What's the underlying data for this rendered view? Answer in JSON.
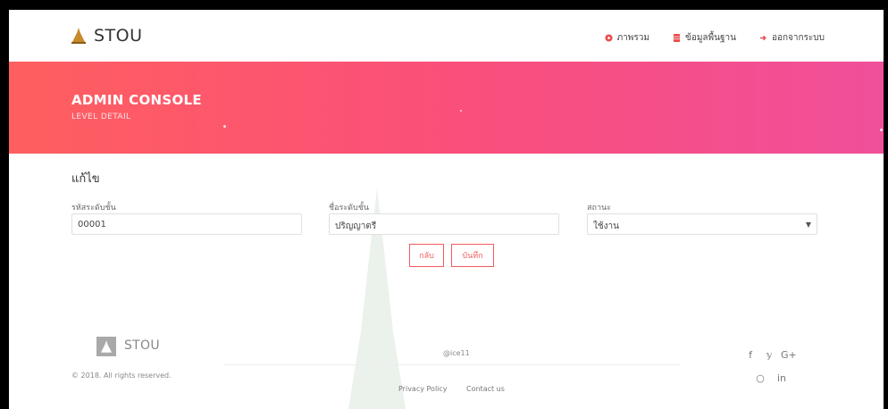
{
  "navbar": {
    "brand": "STOU",
    "items": [
      {
        "label": "ภาพรวม",
        "icon": "dashboard-icon"
      },
      {
        "label": "ข้อมูลพื้นฐาน",
        "icon": "database-icon"
      },
      {
        "label": "ออกจากระบบ",
        "icon": "sign-out-icon"
      }
    ]
  },
  "hero": {
    "title": "ADMIN CONSOLE",
    "subtitle": "LEVEL DETAIL"
  },
  "form": {
    "title": "แก้ไข",
    "fields": [
      {
        "label": "รหัสระดับชั้น",
        "value": "00001"
      },
      {
        "label": "ชื่อระดับชั้น",
        "value": "ปริญญาตรี"
      },
      {
        "label": "สถานะ",
        "value": "ใช้งาน"
      }
    ],
    "back_label": "กลับ",
    "save_label": "บันทึก"
  },
  "footer": {
    "brand": "STOU",
    "copyright": "© 2018. All rights reserved.",
    "credit": "@ice11",
    "links": [
      "Privacy Policy",
      "Contact us"
    ],
    "social": [
      "f",
      "𝕪",
      "G+",
      "○",
      "in"
    ]
  },
  "colors": {
    "accent": "#f25c5c",
    "hero_start": "#ff5f5f",
    "hero_end": "#f04f9a"
  }
}
